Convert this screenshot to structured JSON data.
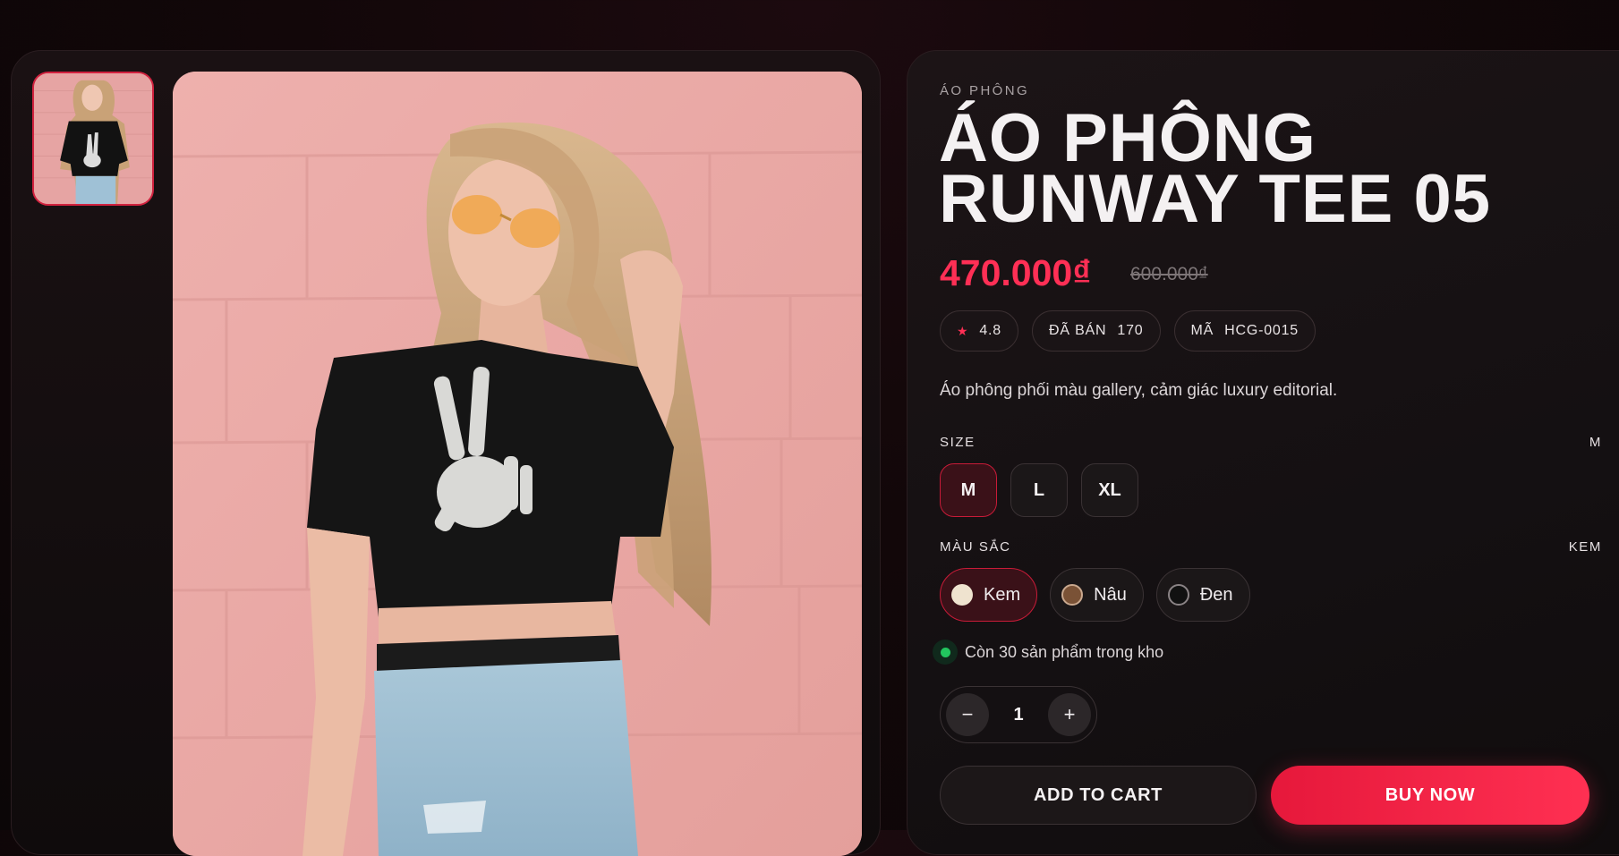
{
  "product": {
    "category": "ÁO PHÔNG",
    "title_line1": "ÁO PHÔNG",
    "title_line2": "RUNWAY TEE 05",
    "price": "470.000₫",
    "old_price": "600.000₫",
    "rating": "4.8",
    "sold_label": "ĐÃ BÁN",
    "sold_count": "170",
    "sku_label": "MÃ",
    "sku": "HCG-0015",
    "description": "Áo phông phối màu gallery, cảm giác luxury editorial."
  },
  "size": {
    "label": "SIZE",
    "selected": "M",
    "options": [
      "M",
      "L",
      "XL"
    ]
  },
  "color": {
    "label": "MÀU SẮC",
    "selected": "KEM",
    "options": [
      {
        "name": "Kem",
        "hex": "#efe3cf"
      },
      {
        "name": "Nâu",
        "hex": "#7a5236"
      },
      {
        "name": "Đen",
        "hex": "#111111"
      }
    ]
  },
  "stock": {
    "text": "Còn 30 sản phẩm trong kho"
  },
  "quantity": {
    "minus": "−",
    "value": "1",
    "plus": "+"
  },
  "actions": {
    "add_to_cart": "ADD TO CART",
    "buy_now": "BUY NOW"
  },
  "theme": {
    "accent": "#ff2f55",
    "background": "#120709",
    "stock_color": "#22c55e"
  }
}
